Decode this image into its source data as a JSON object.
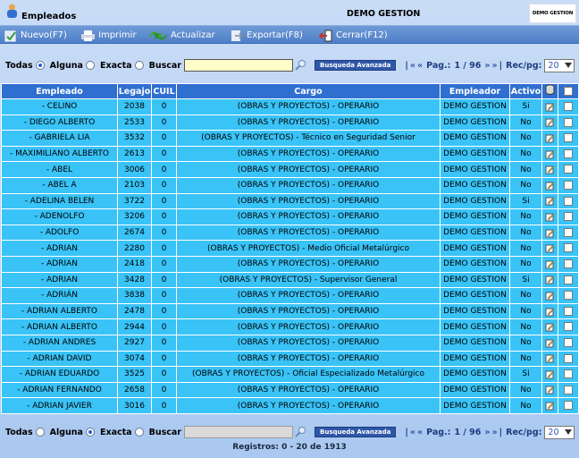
{
  "window": {
    "title": "Empleados",
    "company": "DEMO GESTION",
    "logo_text": "DEMO GESTION"
  },
  "toolbar": {
    "nuevo": "Nuevo(F7)",
    "imprimir": "Imprimir",
    "actualizar": "Actualizar",
    "exportar": "Exportar(F8)",
    "cerrar": "Cerrar(F12)"
  },
  "filter_top": {
    "todas": "Todas",
    "alguna": "Alguna",
    "exacta": "Exacta",
    "buscar": "Buscar",
    "search_value": "",
    "advanced": "Busqueda Avanzada",
    "first": "«",
    "prev": "«",
    "pag_label": "Pag.:",
    "page": "1 / 96",
    "next": "»",
    "last": "»",
    "recpg_label": "Rec/pg:",
    "recpg_value": "20",
    "selected_mode": "todas"
  },
  "filter_bottom": {
    "todas": "Todas",
    "alguna": "Alguna",
    "exacta": "Exacta",
    "buscar": "Buscar",
    "search_value": "",
    "advanced": "Busqueda Avanzada",
    "first": "«",
    "prev": "«",
    "pag_label": "Pag.:",
    "page": "1 / 96",
    "next": "»",
    "last": "»",
    "recpg_label": "Rec/pg:",
    "recpg_value": "20",
    "selected_mode": "alguna"
  },
  "table": {
    "headers": {
      "empleado": "Empleado",
      "legajo": "Legajo",
      "cuil": "CUIL",
      "cargo": "Cargo",
      "empleador": "Empleador",
      "activo": "Activo"
    },
    "rows": [
      {
        "empleado": "- CELINO",
        "legajo": "2038",
        "cuil": "0",
        "cargo": "(OBRAS Y PROYECTOS) - OPERARIO",
        "empleador": "DEMO GESTION",
        "activo": "Si"
      },
      {
        "empleado": "- DIEGO ALBERTO",
        "legajo": "2533",
        "cuil": "0",
        "cargo": "(OBRAS Y PROYECTOS) - OPERARIO",
        "empleador": "DEMO GESTION",
        "activo": "No"
      },
      {
        "empleado": "- GABRIELA LIA",
        "legajo": "3532",
        "cuil": "0",
        "cargo": "(OBRAS Y PROYECTOS) - Técnico en Seguridad Senior",
        "empleador": "DEMO GESTION",
        "activo": "No"
      },
      {
        "empleado": "- MAXIMILIANO ALBERTO",
        "legajo": "2613",
        "cuil": "0",
        "cargo": "(OBRAS Y PROYECTOS) - OPERARIO",
        "empleador": "DEMO GESTION",
        "activo": "No"
      },
      {
        "empleado": "- ABEL",
        "legajo": "3006",
        "cuil": "0",
        "cargo": "(OBRAS Y PROYECTOS) - OPERARIO",
        "empleador": "DEMO GESTION",
        "activo": "No"
      },
      {
        "empleado": "- ABEL A",
        "legajo": "2103",
        "cuil": "0",
        "cargo": "(OBRAS Y PROYECTOS) - OPERARIO",
        "empleador": "DEMO GESTION",
        "activo": "No"
      },
      {
        "empleado": "- ADELINA BELEN",
        "legajo": "3722",
        "cuil": "0",
        "cargo": "(OBRAS Y PROYECTOS) - OPERARIO",
        "empleador": "DEMO GESTION",
        "activo": "Si"
      },
      {
        "empleado": "- ADENOLFO",
        "legajo": "3206",
        "cuil": "0",
        "cargo": "(OBRAS Y PROYECTOS) - OPERARIO",
        "empleador": "DEMO GESTION",
        "activo": "No"
      },
      {
        "empleado": "- ADOLFO",
        "legajo": "2674",
        "cuil": "0",
        "cargo": "(OBRAS Y PROYECTOS) - OPERARIO",
        "empleador": "DEMO GESTION",
        "activo": "No"
      },
      {
        "empleado": "- ADRIAN",
        "legajo": "2280",
        "cuil": "0",
        "cargo": "(OBRAS Y PROYECTOS) - Medio Oficial Metalúrgico",
        "empleador": "DEMO GESTION",
        "activo": "No"
      },
      {
        "empleado": "- ADRIAN",
        "legajo": "2418",
        "cuil": "0",
        "cargo": "(OBRAS Y PROYECTOS) - OPERARIO",
        "empleador": "DEMO GESTION",
        "activo": "No"
      },
      {
        "empleado": "- ADRIAN",
        "legajo": "3428",
        "cuil": "0",
        "cargo": "(OBRAS Y PROYECTOS) - Supervisor General",
        "empleador": "DEMO GESTION",
        "activo": "Si"
      },
      {
        "empleado": "- ADRIÁN",
        "legajo": "3838",
        "cuil": "0",
        "cargo": "(OBRAS Y PROYECTOS) - OPERARIO",
        "empleador": "DEMO GESTION",
        "activo": "No"
      },
      {
        "empleado": "- ADRIAN ALBERTO",
        "legajo": "2478",
        "cuil": "0",
        "cargo": "(OBRAS Y PROYECTOS) - OPERARIO",
        "empleador": "DEMO GESTION",
        "activo": "No"
      },
      {
        "empleado": "- ADRIAN ALBERTO",
        "legajo": "2944",
        "cuil": "0",
        "cargo": "(OBRAS Y PROYECTOS) - OPERARIO",
        "empleador": "DEMO GESTION",
        "activo": "No"
      },
      {
        "empleado": "- ADRIAN ANDRES",
        "legajo": "2927",
        "cuil": "0",
        "cargo": "(OBRAS Y PROYECTOS) - OPERARIO",
        "empleador": "DEMO GESTION",
        "activo": "No"
      },
      {
        "empleado": "- ADRIAN DAVID",
        "legajo": "3074",
        "cuil": "0",
        "cargo": "(OBRAS Y PROYECTOS) - OPERARIO",
        "empleador": "DEMO GESTION",
        "activo": "No"
      },
      {
        "empleado": "- ADRIAN EDUARDO",
        "legajo": "3525",
        "cuil": "0",
        "cargo": "(OBRAS Y PROYECTOS) - Oficial Especializado Metalúrgico",
        "empleador": "DEMO GESTION",
        "activo": "Si"
      },
      {
        "empleado": "- ADRIAN FERNANDO",
        "legajo": "2658",
        "cuil": "0",
        "cargo": "(OBRAS Y PROYECTOS) - OPERARIO",
        "empleador": "DEMO GESTION",
        "activo": "No"
      },
      {
        "empleado": "- ADRIAN JAVIER",
        "legajo": "3016",
        "cuil": "0",
        "cargo": "(OBRAS Y PROYECTOS) - OPERARIO",
        "empleador": "DEMO GESTION",
        "activo": "No"
      }
    ]
  },
  "footer": {
    "registros": "Registros: 0 - 20 de 1913"
  },
  "colors": {
    "header_bg": "#2f6fd0",
    "row_bg": "#39c3f7",
    "menubar": "#5a88cc",
    "search_bg": "#fffcc8",
    "pager_link": "#2f57a8"
  }
}
